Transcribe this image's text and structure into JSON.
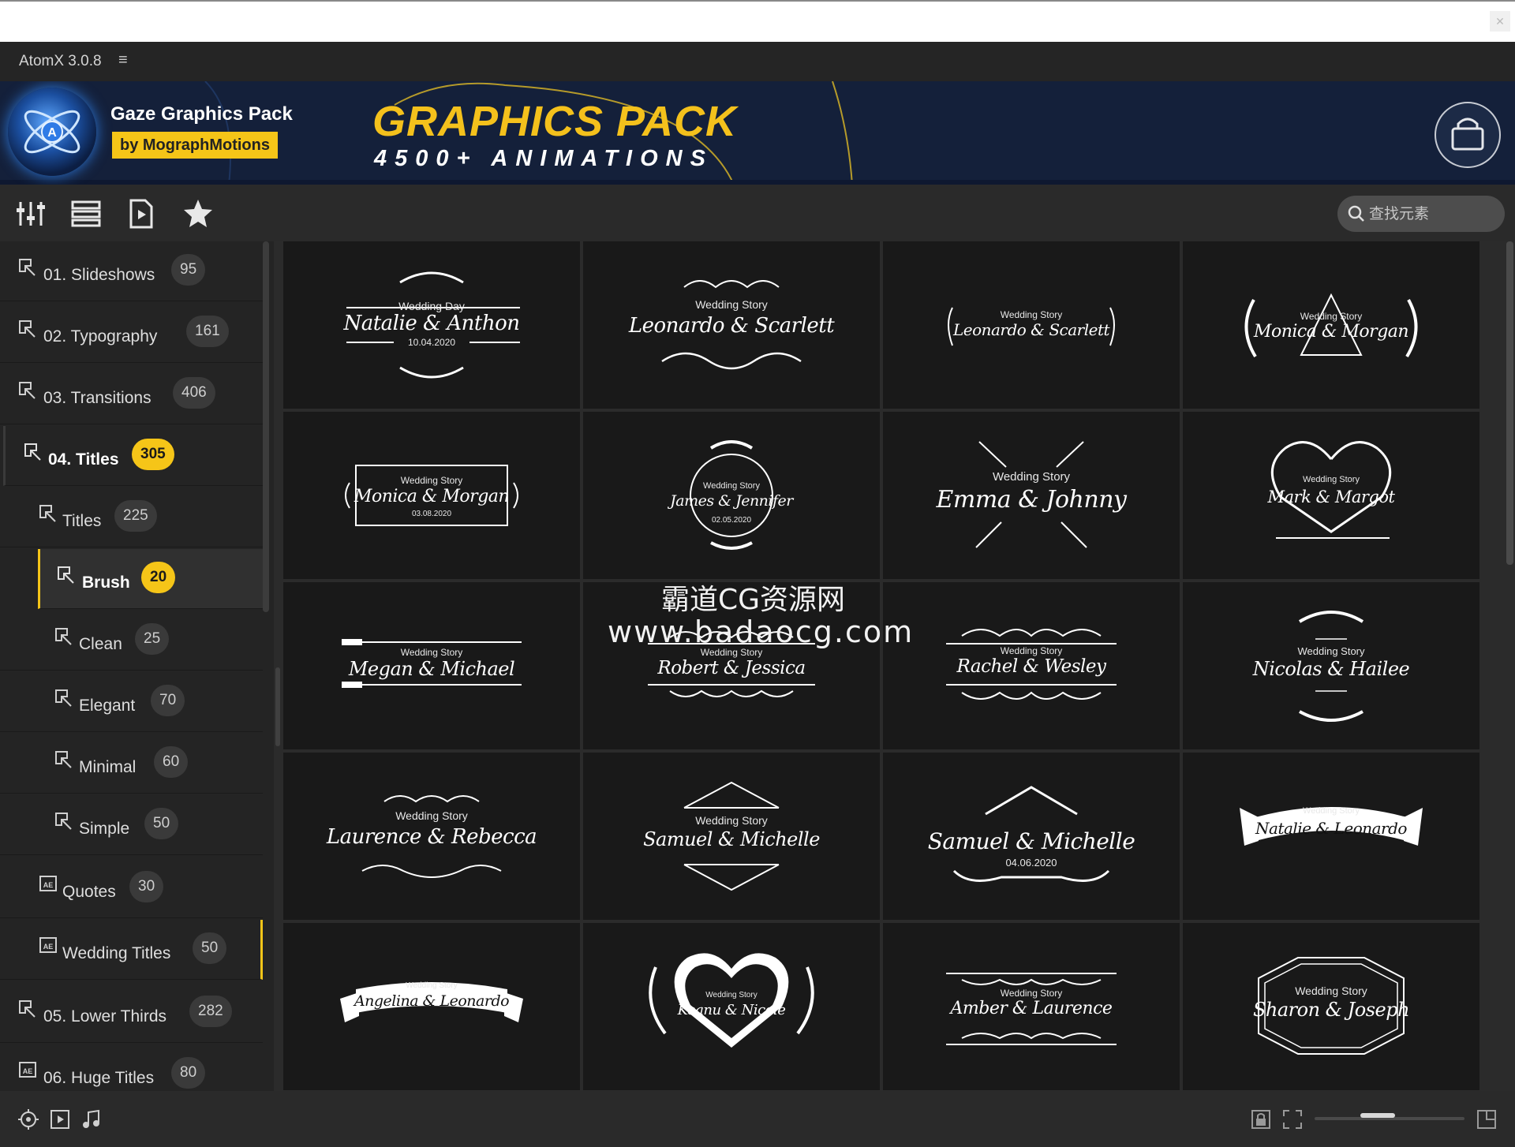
{
  "app": {
    "title": "AtomX 3.0.8",
    "menu_icon": "≡"
  },
  "banner": {
    "pack_name": "Gaze Graphics Pack",
    "by_label": "by MographMotions",
    "headline": "GRAPHICS PACK",
    "subline": "4500+ ANIMATIONS"
  },
  "search": {
    "placeholder": "查找元素"
  },
  "sidebar": {
    "items": [
      {
        "label": "01. Slideshows",
        "count": "95"
      },
      {
        "label": "02. Typography",
        "count": "161"
      },
      {
        "label": "03. Transitions",
        "count": "406"
      },
      {
        "label": "04. Titles",
        "count": "305"
      },
      {
        "label": "Titles",
        "count": "225"
      },
      {
        "label": "Brush",
        "count": "20"
      },
      {
        "label": "Clean",
        "count": "25"
      },
      {
        "label": "Elegant",
        "count": "70"
      },
      {
        "label": "Minimal",
        "count": "60"
      },
      {
        "label": "Simple",
        "count": "50"
      },
      {
        "label": "Quotes",
        "count": "30"
      },
      {
        "label": "Wedding Titles",
        "count": "50"
      },
      {
        "label": "05. Lower Thirds",
        "count": "282"
      },
      {
        "label": "06. Huge Titles",
        "count": "80"
      }
    ]
  },
  "tiles": [
    {
      "small": "Wedding Day",
      "names": "Natalie & Anthon",
      "date": "10.04.2020"
    },
    {
      "small": "Wedding Story",
      "names": "Leonardo & Scarlett",
      "date": ""
    },
    {
      "small": "Wedding Story",
      "names": "Leonardo & Scarlett",
      "date": ""
    },
    {
      "small": "Wedding Story",
      "names": "Monica & Morgan",
      "date": ""
    },
    {
      "small": "Wedding Story",
      "names": "Monica & Morgan",
      "date": "03.08.2020"
    },
    {
      "small": "Wedding Story",
      "names": "James & Jennifer",
      "date": "02.05.2020"
    },
    {
      "small": "Wedding Story",
      "names": "Emma & Johnny",
      "date": ""
    },
    {
      "small": "Wedding Story",
      "names": "Mark & Margot",
      "date": ""
    },
    {
      "small": "Wedding Story",
      "names": "Megan & Michael",
      "date": ""
    },
    {
      "small": "Wedding Story",
      "names": "Robert & Jessica",
      "date": ""
    },
    {
      "small": "Wedding Story",
      "names": "Rachel & Wesley",
      "date": ""
    },
    {
      "small": "Wedding Story",
      "names": "Nicolas & Hailee",
      "date": ""
    },
    {
      "small": "Wedding Story",
      "names": "Laurence & Rebecca",
      "date": ""
    },
    {
      "small": "Wedding Story",
      "names": "Samuel & Michelle",
      "date": ""
    },
    {
      "small": "",
      "names": "Samuel & Michelle",
      "date": "04.06.2020"
    },
    {
      "small": "Wedding Story",
      "names": "Natalie & Leonardo",
      "date": ""
    },
    {
      "small": "Wedding Story",
      "names": "Angelina & Leonardo",
      "date": ""
    },
    {
      "small": "Wedding Story",
      "names": "Keanu & Nicole",
      "date": ""
    },
    {
      "small": "Wedding Story",
      "names": "Amber & Laurence",
      "date": ""
    },
    {
      "small": "Wedding Story",
      "names": "Sharon & Joseph",
      "date": ""
    }
  ],
  "watermark": {
    "line1": "霸道CG资源网",
    "line2": "www.badaocg.com"
  },
  "colors": {
    "accent": "#f5c518",
    "banner_bg": "#14203a",
    "panel_bg": "#232323",
    "tile_bg": "#191919"
  }
}
